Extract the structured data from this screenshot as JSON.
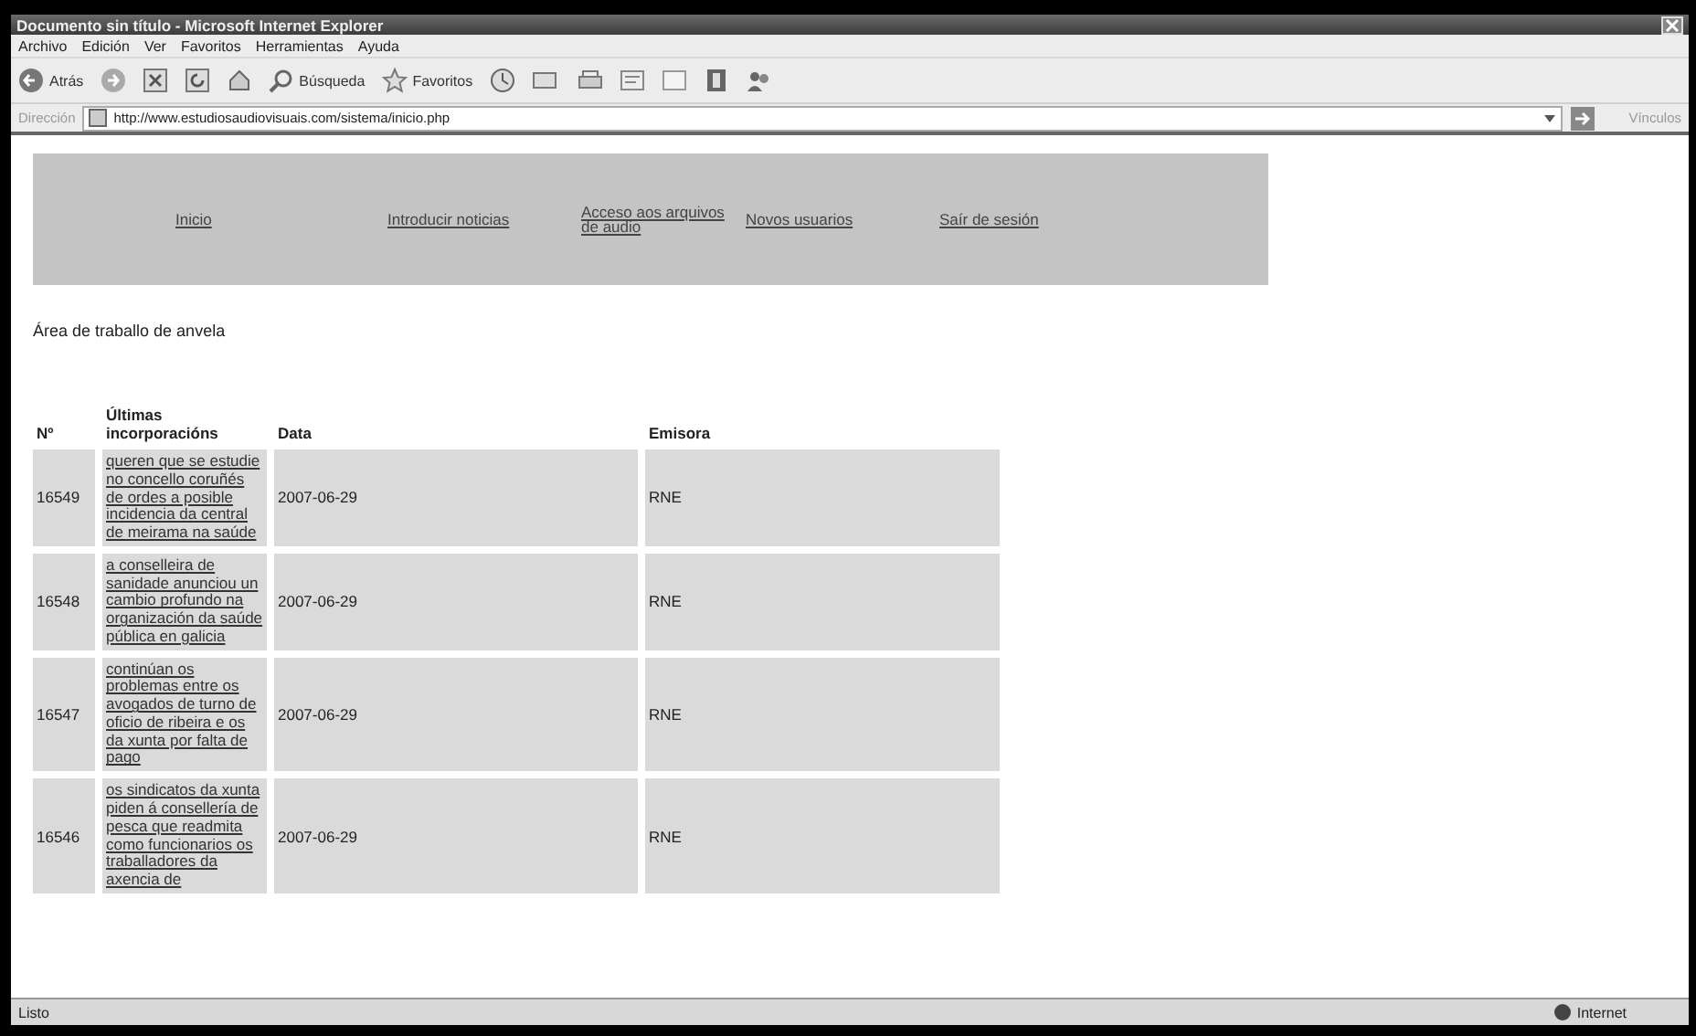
{
  "window": {
    "title": "Documento sin título - Microsoft Internet Explorer"
  },
  "menu": [
    "Archivo",
    "Edición",
    "Ver",
    "Favoritos",
    "Herramientas",
    "Ayuda"
  ],
  "toolbar": {
    "back": "Atrás",
    "search": "Búsqueda",
    "favorites": "Favoritos"
  },
  "address_bar": {
    "label": "Dirección",
    "value": "http://www.estudiosaudiovisuais.com/sistema/inicio.php",
    "links": "Vínculos"
  },
  "nav": [
    "Inicio",
    "Introducir noticias",
    "Acceso aos arquivos de audio",
    "Novos usuarios",
    "Saír de sesión"
  ],
  "workspace": "Área de traballo de anvela",
  "table": {
    "columns": [
      "Nº",
      "Últimas incorporacións",
      "Data",
      "Emisora"
    ],
    "rows": [
      {
        "number": "16549",
        "title": "queren que se estudie no concello coruñés de ordes a posible incidencia da central de meirama na saúde",
        "date": "2007-06-29",
        "station": "RNE"
      },
      {
        "number": "16548",
        "title": "a conselleira de sanidade anunciou un cambio profundo na organización da saúde pública en galicia",
        "date": "2007-06-29",
        "station": "RNE"
      },
      {
        "number": "16547",
        "title": "continúan os problemas entre os avogados de turno de oficio de ribeira e os da xunta por falta de pago",
        "date": "2007-06-29",
        "station": "RNE"
      },
      {
        "number": "16546",
        "title": "os sindicatos da xunta piden á consellería de pesca que readmita como funcionarios os traballadores da axencia de",
        "date": "2007-06-29",
        "station": "RNE"
      }
    ]
  },
  "status_bar": {
    "text": "Listo",
    "zone": "Internet"
  }
}
